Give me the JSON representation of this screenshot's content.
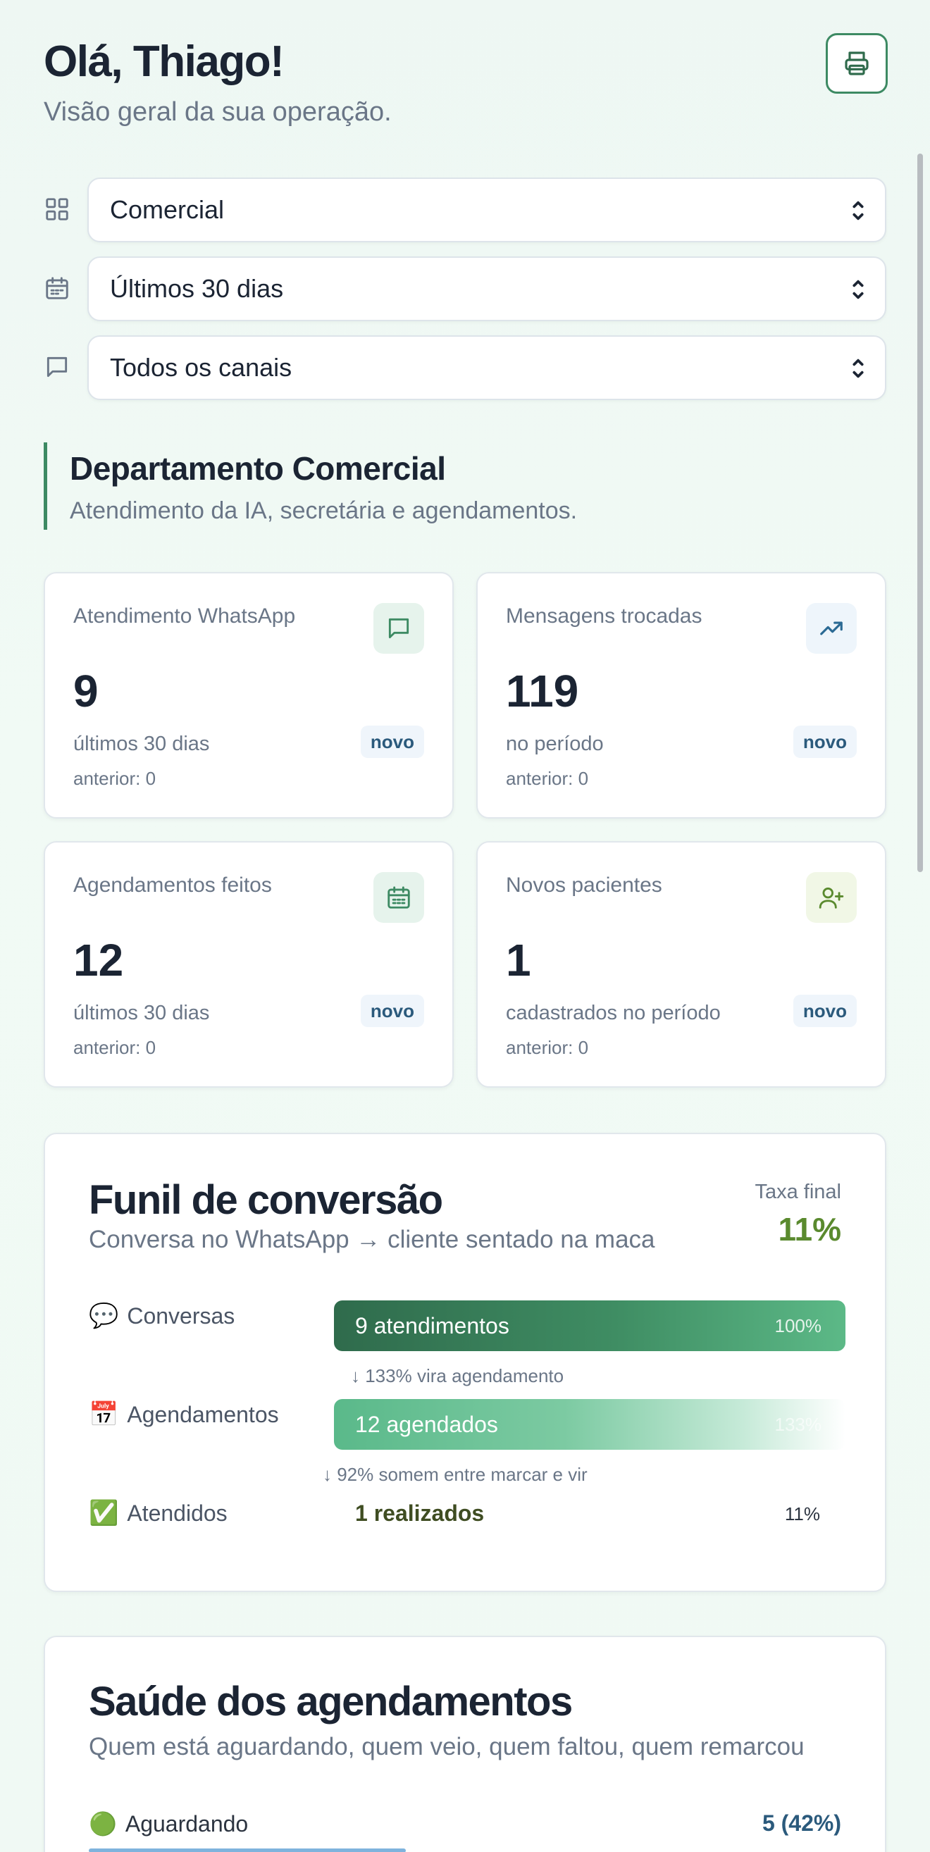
{
  "header": {
    "greeting": "Olá, Thiago!",
    "subtitle": "Visão geral da sua operação.",
    "print_icon": "printer-icon"
  },
  "filters": [
    {
      "icon": "grid-icon",
      "value": "Comercial"
    },
    {
      "icon": "calendar-icon",
      "value": "Últimos 30 dias"
    },
    {
      "icon": "message-icon",
      "value": "Todos os canais"
    }
  ],
  "department": {
    "title": "Departamento Comercial",
    "subtitle": "Atendimento da IA, secretária e agendamentos."
  },
  "cards": [
    {
      "label": "Atendimento WhatsApp",
      "value": "9",
      "caption": "últimos 30 dias",
      "previous": "anterior: 0",
      "badge": "novo",
      "icon": "message-icon",
      "icon_bg": "#e6f3ec",
      "icon_color": "#3d8a63"
    },
    {
      "label": "Mensagens trocadas",
      "value": "119",
      "caption": "no período",
      "previous": "anterior: 0",
      "badge": "novo",
      "icon": "trending-up-icon",
      "icon_bg": "#eef5fb",
      "icon_color": "#2b6a94"
    },
    {
      "label": "Agendamentos feitos",
      "value": "12",
      "caption": "últimos 30 dias",
      "previous": "anterior: 0",
      "badge": "novo",
      "icon": "calendar-icon",
      "icon_bg": "#e6f3ec",
      "icon_color": "#3d8a63"
    },
    {
      "label": "Novos pacientes",
      "value": "1",
      "caption": "cadastrados no período",
      "previous": "anterior: 0",
      "badge": "novo",
      "icon": "user-plus-icon",
      "icon_bg": "#f1f7e6",
      "icon_color": "#5a8a2e"
    }
  ],
  "funnel": {
    "title": "Funil de conversão",
    "subtitle": "Conversa no WhatsApp → cliente sentado na maca",
    "final_rate_label": "Taxa final",
    "final_rate_value": "11%",
    "stages": [
      {
        "emoji": "💬",
        "label": "Conversas",
        "bar_text": "9 atendimentos",
        "pct": "100%",
        "fill": 1.0
      },
      {
        "emoji": "📅",
        "label": "Agendamentos",
        "bar_text": "12 agendados",
        "pct": "133%",
        "fill": 1.0
      },
      {
        "emoji": "✅",
        "label": "Atendidos",
        "bar_text": "1 realizados",
        "pct": "11%",
        "fill": 0.11
      }
    ],
    "notes": [
      "↓ 133% vira agendamento",
      "↓ 92% somem entre marcar e vir"
    ]
  },
  "health": {
    "title": "Saúde dos agendamentos",
    "subtitle": "Quem está aguardando, quem veio, quem faltou, quem remarcou",
    "rows": [
      {
        "emoji": "🟢",
        "label": "Aguardando",
        "value": "5 (42%)",
        "fill": 0.42
      }
    ]
  },
  "colors": {
    "accent": "#3d8a63",
    "final_rate": "#5a8a2e",
    "badge_text": "#2b5a7c"
  }
}
